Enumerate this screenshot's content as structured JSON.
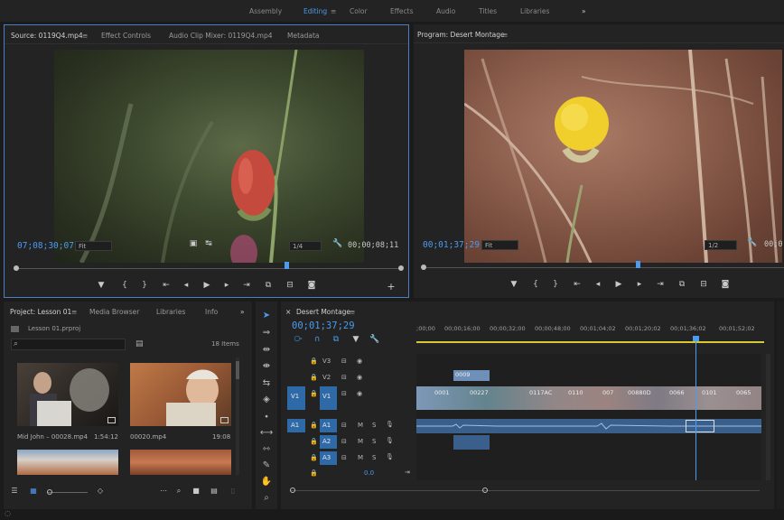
{
  "workspaces": {
    "items": [
      "Assembly",
      "Editing",
      "Color",
      "Effects",
      "Audio",
      "Titles",
      "Libraries"
    ],
    "active": "Editing",
    "menu_glyph": "≡",
    "more_glyph": "»"
  },
  "source_panel": {
    "tabs": [
      "Source: 0119Q4.mp4",
      "Effect Controls",
      "Audio Clip Mixer: 0119Q4.mp4",
      "Metadata"
    ],
    "tab_menu": "≡",
    "timecode": "07;08;30;07",
    "fit": "Fit",
    "resolution": "1/4",
    "duration": "00;00;08;11"
  },
  "program_panel": {
    "title": "Program: Desert Montage",
    "tab_menu": "≡",
    "timecode": "00;01;37;29",
    "fit": "Fit",
    "resolution": "1/2",
    "duration": "00;0"
  },
  "project_panel": {
    "tabs": [
      "Project: Lesson 01",
      "Media Browser",
      "Libraries",
      "Info"
    ],
    "tab_menu": "≡",
    "more_glyph": "»",
    "file": "Lesson 01.prproj",
    "items_count": "18 Items",
    "clips": [
      {
        "name": "Mid John – 00028.mp4",
        "duration": "1:54:12"
      },
      {
        "name": "00020.mp4",
        "duration": "19:08"
      }
    ]
  },
  "timeline": {
    "title": "Desert Montage",
    "tab_menu": "≡",
    "close_glyph": "×",
    "timecode": "00;01;37;29",
    "ruler": [
      ";00;00",
      "00;00;16;00",
      "00;00;32;00",
      "00;00;48;00",
      "00;01;04;02",
      "00;01;20;02",
      "00;01;36;02",
      "00;01;52;02"
    ],
    "tracks": {
      "v3": "V3",
      "v2": "V2",
      "v1": "V1",
      "v1_src": "V1",
      "a1": "A1",
      "a1_src": "A1",
      "a2": "A2",
      "a3": "A3"
    },
    "master_value": "0.0",
    "m": "M",
    "s": "S",
    "v2_clip": "0009",
    "v1_clips": [
      "0001",
      "00227",
      "0117AC",
      "0110",
      "007",
      "00880D",
      "0066",
      "0101",
      "0065"
    ]
  },
  "icons": {
    "menu": "≡",
    "more": "»",
    "lock": "🔒"
  },
  "colors": {
    "accent": "#4b9bef",
    "panel_bg": "#232323",
    "video_clip": "#6e8fb8",
    "audio_clip": "#3a5f8a"
  }
}
